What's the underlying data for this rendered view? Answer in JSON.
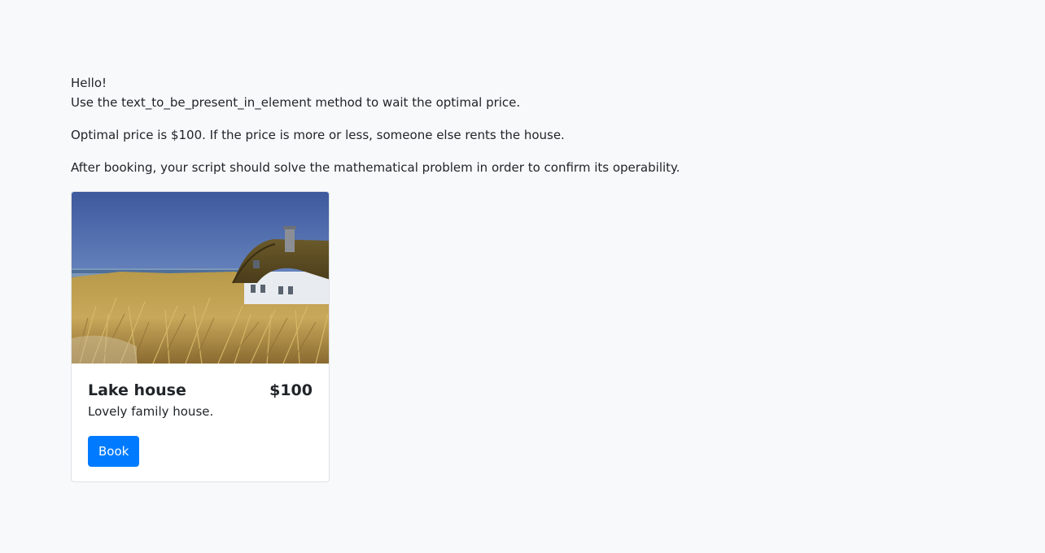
{
  "intro": {
    "greeting": "Hello!",
    "instruction": "Use the text_to_be_present_in_element method to wait the optimal price."
  },
  "paragraphs": {
    "price_note": "Optimal price is $100. If the price is more or less, someone else rents the house.",
    "booking_note": "After booking, your script should solve the mathematical problem in order to confirm its operability."
  },
  "card": {
    "title": "Lake house",
    "price": "$100",
    "description": "Lovely family house.",
    "button_label": "Book",
    "button_color": "#007bff"
  }
}
